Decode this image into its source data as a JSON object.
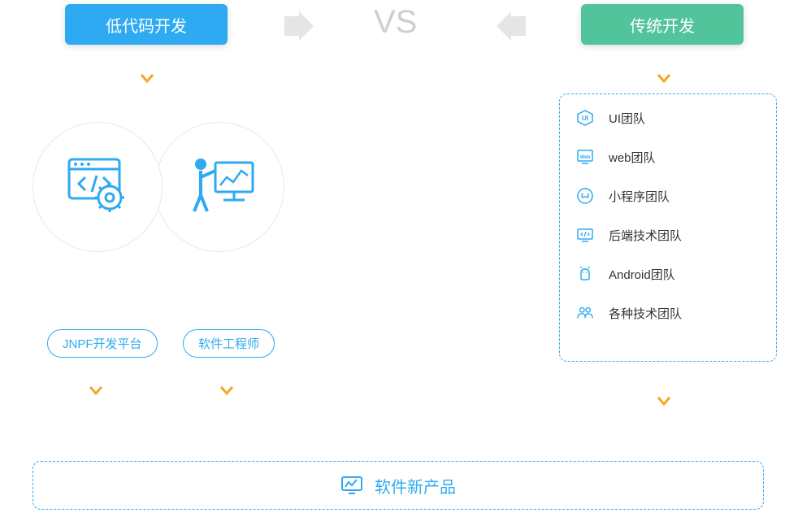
{
  "header": {
    "left": "低代码开发",
    "right": "传统开发",
    "vs": "VS"
  },
  "pills": {
    "platform": "JNPF开发平台",
    "engineer": "软件工程师"
  },
  "teams": [
    {
      "icon": "ui",
      "label": "UI团队"
    },
    {
      "icon": "web",
      "label": "web团队"
    },
    {
      "icon": "mini",
      "label": "小程序团队"
    },
    {
      "icon": "backend",
      "label": "后端技术团队"
    },
    {
      "icon": "android",
      "label": "Android团队"
    },
    {
      "icon": "various",
      "label": "各种技术团队"
    }
  ],
  "result": "软件新产品",
  "colors": {
    "blue": "#2eaaf2",
    "green": "#52c49c",
    "orange": "#f5a623",
    "gray": "#e5e5e5"
  }
}
